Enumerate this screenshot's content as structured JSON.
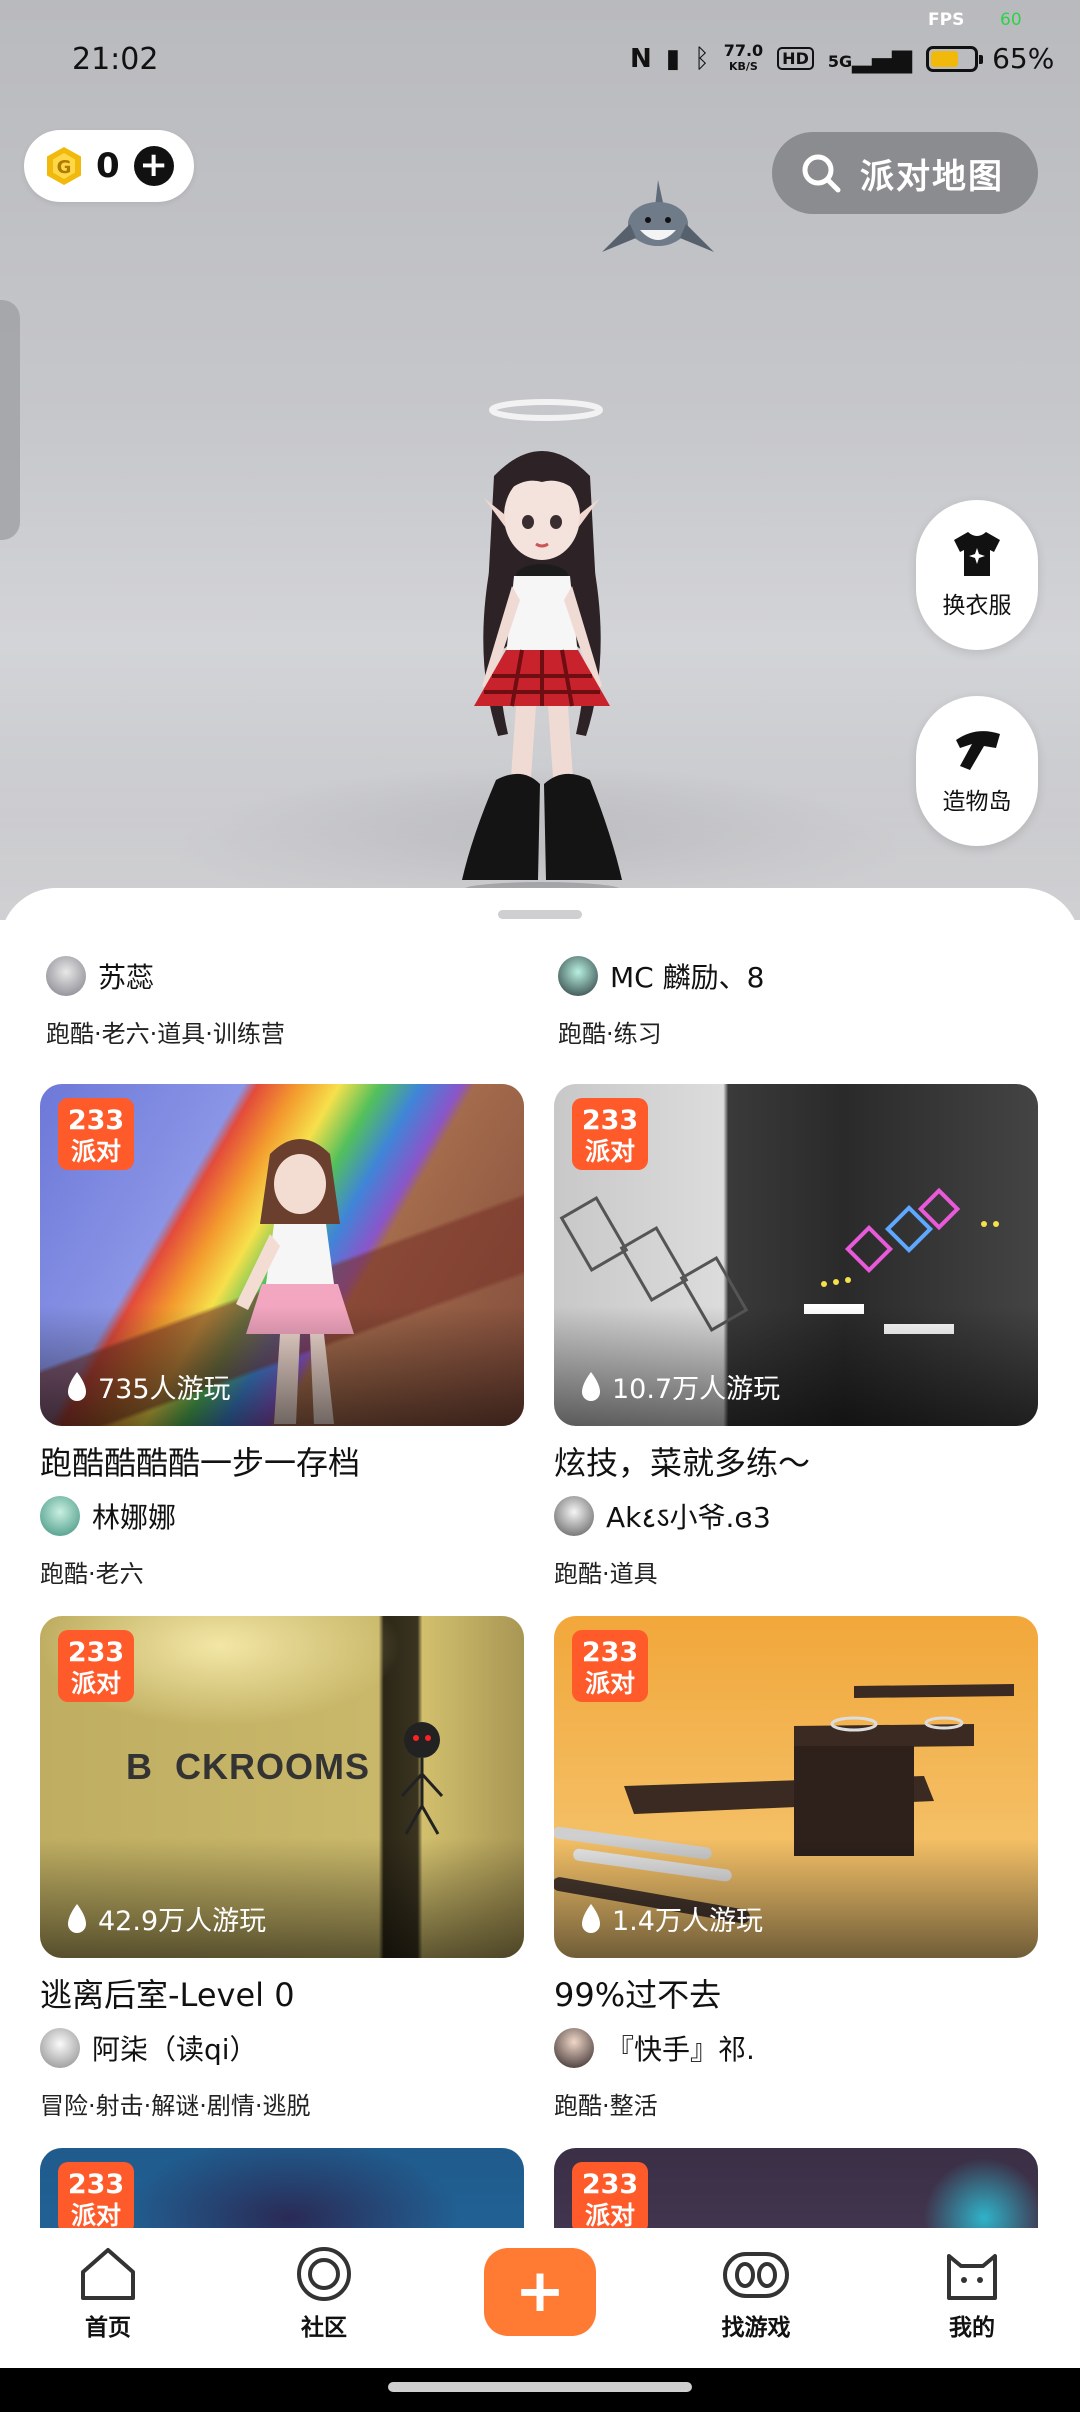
{
  "status_bar": {
    "time": "21:02",
    "fps_label": "FPS",
    "fps_value": "60",
    "net_speed_value": "77.0",
    "net_speed_unit": "KB/S",
    "hd_label": "HD",
    "signal_label": "5G",
    "battery_percent": "65%",
    "battery_level": 0.65
  },
  "top": {
    "coin_count": "0",
    "map_button_label": "派对地图"
  },
  "side_buttons": {
    "wardrobe_label": "换衣服",
    "island_label": "造物岛"
  },
  "previous_row": [
    {
      "author": "苏蕊",
      "tags": "跑酷·老六·道具·训练营"
    },
    {
      "author": "MC 麟励、8",
      "tags": "跑酷·练习"
    }
  ],
  "cards": [
    {
      "badge_top": "233",
      "badge_bottom": "派对",
      "plays": "735人游玩",
      "title": "跑酷酷酷酷一步一存档",
      "author": "林娜娜",
      "tags": "跑酷·老六"
    },
    {
      "badge_top": "233",
      "badge_bottom": "派对",
      "plays": "10.7万人游玩",
      "title": "炫技，菜就多练～",
      "author": "Ak٤ऽ小爷.ɞ3",
      "tags": "跑酷·道具"
    },
    {
      "badge_top": "233",
      "badge_bottom": "派对",
      "plays": "42.9万人游玩",
      "title": "逃离后室-Level 0",
      "author": "阿柒（读qi）",
      "tags": "冒险·射击·解谜·剧情·逃脱",
      "thumb_text": "B  CKROOMS"
    },
    {
      "badge_top": "233",
      "badge_bottom": "派对",
      "plays": "1.4万人游玩",
      "title": "99%过不去",
      "author": "『快手』祁.",
      "tags": "跑酷·整活"
    },
    {
      "badge_top": "233",
      "badge_bottom": "派对"
    },
    {
      "badge_top": "233",
      "badge_bottom": "派对"
    }
  ],
  "tab_bar": {
    "home": "首页",
    "community": "社区",
    "add": "+",
    "find_games": "找游戏",
    "me": "我的"
  },
  "icons": {
    "coin": "coin-icon",
    "add": "plus-icon",
    "map_search": "search-icon",
    "wardrobe": "shirt-icon",
    "island": "build-icon",
    "plays": "flame-icon",
    "home": "home-icon",
    "community": "circle-icon",
    "find_games": "eyes-icon",
    "me": "cat-icon"
  },
  "colors": {
    "accent": "#ff7a33",
    "coin": "#f2b90d",
    "badge": "#ff5a2a"
  }
}
